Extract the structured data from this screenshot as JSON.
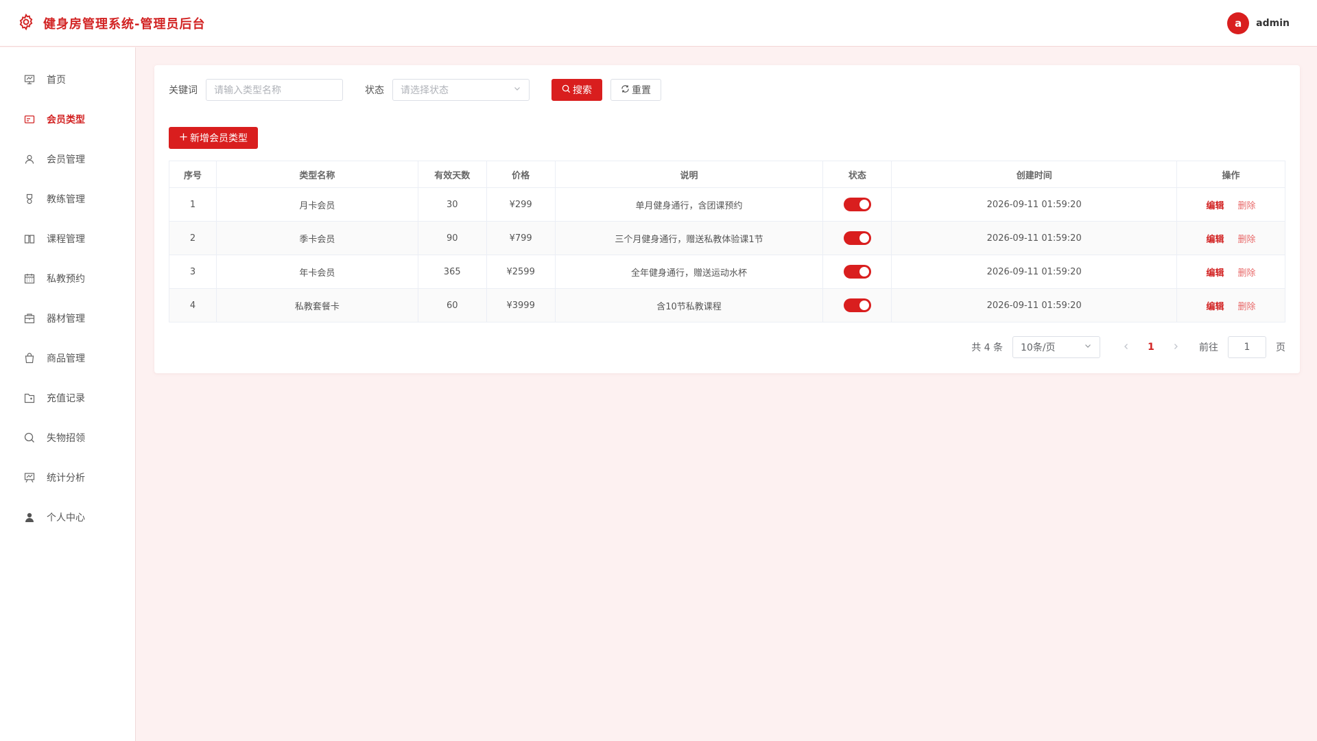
{
  "colors": {
    "accent": "#d91e1e",
    "brand_text": "#d22323",
    "background": "#fdf1f1"
  },
  "header": {
    "title": "健身房管理系统-管理员后台",
    "avatar_letter": "a",
    "username": "admin"
  },
  "sidebar": {
    "items": [
      {
        "label": "首页",
        "icon": "chart-board-icon"
      },
      {
        "label": "会员类型",
        "icon": "card-icon",
        "active": true
      },
      {
        "label": "会员管理",
        "icon": "user-icon"
      },
      {
        "label": "教练管理",
        "icon": "medal-icon"
      },
      {
        "label": "课程管理",
        "icon": "book-icon"
      },
      {
        "label": "私教预约",
        "icon": "calendar-icon"
      },
      {
        "label": "器材管理",
        "icon": "box-icon"
      },
      {
        "label": "商品管理",
        "icon": "bag-icon"
      },
      {
        "label": "充值记录",
        "icon": "folder-icon"
      },
      {
        "label": "失物招领",
        "icon": "search-icon"
      },
      {
        "label": "统计分析",
        "icon": "presentation-icon"
      },
      {
        "label": "个人中心",
        "icon": "person-filled-icon"
      }
    ]
  },
  "filters": {
    "keyword_label": "关键词",
    "keyword_placeholder": "请输入类型名称",
    "status_label": "状态",
    "status_placeholder": "请选择状态",
    "search_label": "搜索",
    "reset_label": "重置"
  },
  "add_button_label": "新增会员类型",
  "table": {
    "columns": [
      "序号",
      "类型名称",
      "有效天数",
      "价格",
      "说明",
      "状态",
      "创建时间",
      "操作"
    ],
    "rows": [
      {
        "index": "1",
        "name": "月卡会员",
        "days": "30",
        "price": "¥299",
        "desc": "单月健身通行，含团课预约",
        "status": true,
        "created": "2026-09-11 01:59:20"
      },
      {
        "index": "2",
        "name": "季卡会员",
        "days": "90",
        "price": "¥799",
        "desc": "三个月健身通行，赠送私教体验课1节",
        "status": true,
        "created": "2026-09-11 01:59:20"
      },
      {
        "index": "3",
        "name": "年卡会员",
        "days": "365",
        "price": "¥2599",
        "desc": "全年健身通行，赠送运动水杯",
        "status": true,
        "created": "2026-09-11 01:59:20"
      },
      {
        "index": "4",
        "name": "私教套餐卡",
        "days": "60",
        "price": "¥3999",
        "desc": "含10节私教课程",
        "status": true,
        "created": "2026-09-11 01:59:20"
      }
    ],
    "edit_label": "编辑",
    "delete_label": "删除"
  },
  "pagination": {
    "total_text": "共 4 条",
    "page_size": "10条/页",
    "current_page": "1",
    "goto_label": "前往",
    "goto_value": "1",
    "page_suffix": "页"
  }
}
